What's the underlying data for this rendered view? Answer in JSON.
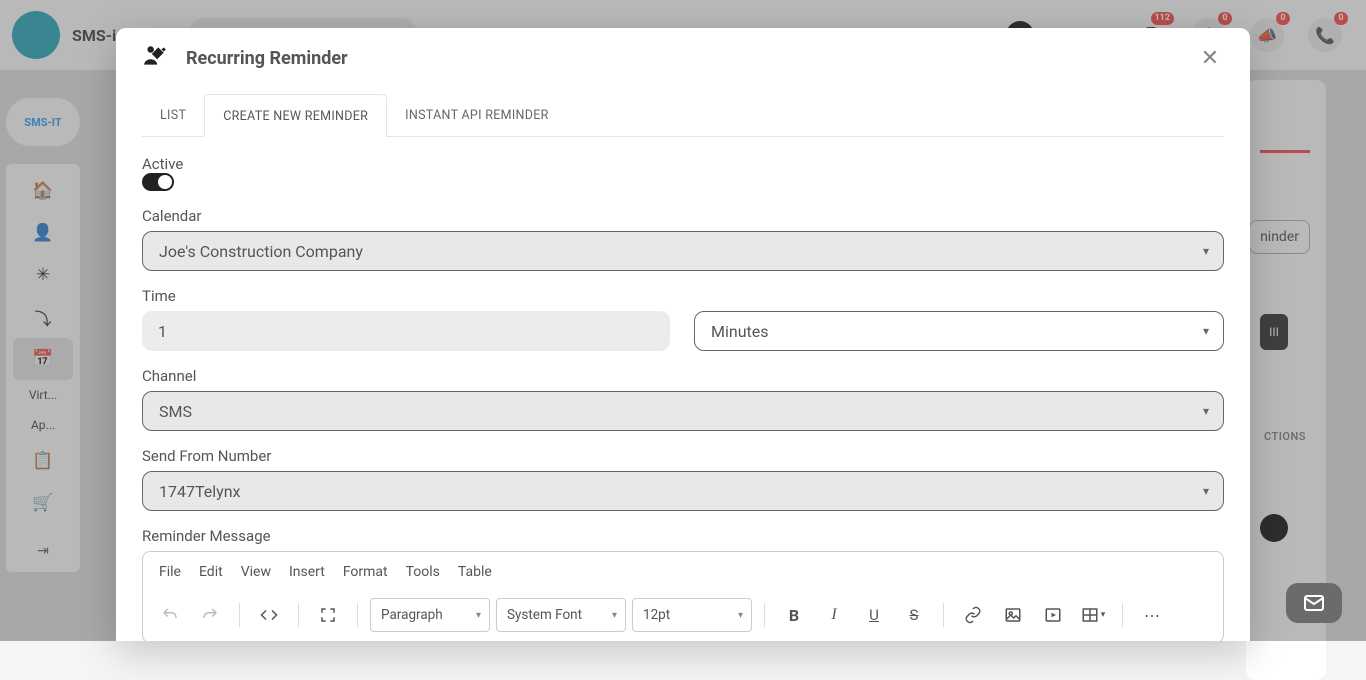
{
  "header": {
    "brand": "SMS-i",
    "badge_msg": "112",
    "badge_bell": "0",
    "badge_horn": "0",
    "badge_phone": "0"
  },
  "left_rail": {
    "logo": "SMS-IT",
    "items": [
      {
        "name": "home-icon"
      },
      {
        "name": "user-icon"
      },
      {
        "name": "network-icon"
      },
      {
        "name": "flow-icon"
      },
      {
        "name": "calendar-icon"
      }
    ],
    "text_items": [
      "Virt...",
      "Ap..."
    ],
    "extra_icons": [
      "doc-icon",
      "cart-icon",
      "collapse-icon"
    ]
  },
  "bg": {
    "reminder_btn": "ninder",
    "view_chip": "III",
    "actions_label": "CTIONS"
  },
  "modal": {
    "title": "Recurring Reminder",
    "tabs": {
      "list": "LIST",
      "create": "CREATE NEW REMINDER",
      "api": "INSTANT API REMINDER"
    },
    "labels": {
      "active": "Active",
      "calendar": "Calendar",
      "time": "Time",
      "channel": "Channel",
      "send_from": "Send From Number",
      "message": "Reminder Message"
    },
    "values": {
      "calendar": "Joe's Construction Company",
      "time_qty": "1",
      "time_unit": "Minutes",
      "channel": "SMS",
      "send_from": "1747Telynx"
    },
    "editor": {
      "menus": [
        "File",
        "Edit",
        "View",
        "Insert",
        "Format",
        "Tools",
        "Table"
      ],
      "block": "Paragraph",
      "font": "System Font",
      "size": "12pt"
    }
  }
}
